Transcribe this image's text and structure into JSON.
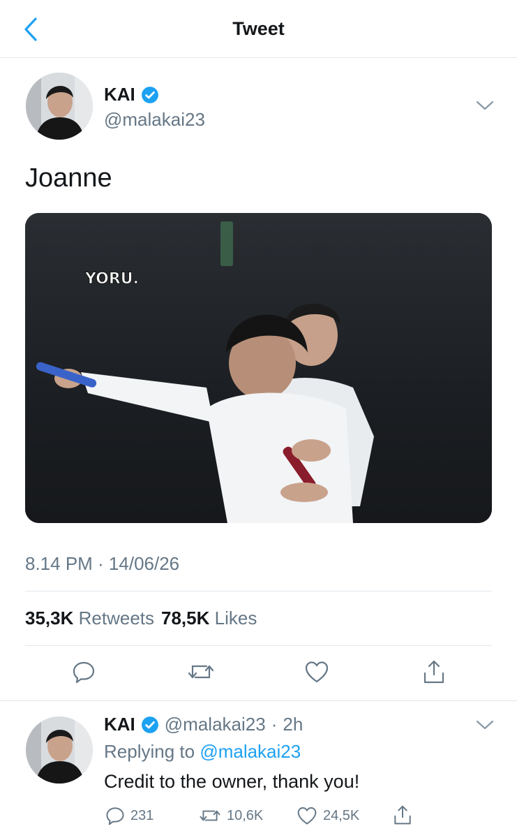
{
  "header": {
    "title": "Tweet"
  },
  "tweet": {
    "author_name": "KAI",
    "author_handle": "@malakai23",
    "text": "Joanne",
    "media_watermark": "YORU.",
    "timestamp": "8.14 PM · 14/06/26",
    "retweet_count": "35,3K",
    "retweet_label": "Retweets",
    "like_count": "78,5K",
    "like_label": "Likes"
  },
  "reply": {
    "author_name": "KAI",
    "author_handle": "@malakai23",
    "separator": "·",
    "time": "2h",
    "replying_prefix": "Replying to",
    "replying_to": "@malakai23",
    "text": "Credit to the owner, thank you!",
    "reply_count": "231",
    "retweet_count": "10,6K",
    "like_count": "24,5K"
  },
  "colors": {
    "accent": "#1da1f2",
    "text": "#14171a",
    "secondary": "#657786",
    "divider": "#e1e8ed"
  },
  "icons": [
    "back-chevron-icon",
    "verified-badge-icon",
    "chevron-down-icon",
    "reply-icon",
    "retweet-icon",
    "like-icon",
    "share-icon"
  ]
}
